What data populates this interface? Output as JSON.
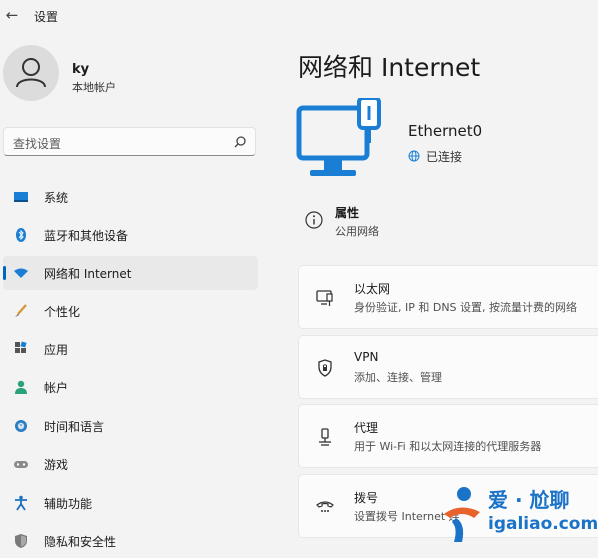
{
  "titlebar": {
    "back_glyph": "←",
    "title": "设置"
  },
  "user": {
    "name": "ky",
    "account_type": "本地帐户"
  },
  "search": {
    "placeholder": "查找设置"
  },
  "sidebar": {
    "items": [
      {
        "label": "系统",
        "icon": "system-icon"
      },
      {
        "label": "蓝牙和其他设备",
        "icon": "bluetooth-icon"
      },
      {
        "label": "网络和 Internet",
        "icon": "network-icon",
        "selected": true
      },
      {
        "label": "个性化",
        "icon": "brush-icon"
      },
      {
        "label": "应用",
        "icon": "apps-icon"
      },
      {
        "label": "帐户",
        "icon": "account-icon"
      },
      {
        "label": "时间和语言",
        "icon": "time-language-icon"
      },
      {
        "label": "游戏",
        "icon": "gamepad-icon"
      },
      {
        "label": "辅助功能",
        "icon": "accessibility-icon"
      },
      {
        "label": "隐私和安全性",
        "icon": "shield-icon"
      }
    ]
  },
  "main": {
    "title": "网络和 Internet",
    "connection": {
      "name": "Ethernet0",
      "status": "已连接"
    },
    "properties": {
      "title": "属性",
      "subtitle": "公用网络"
    },
    "cards": [
      {
        "title": "以太网",
        "subtitle": "身份验证, IP 和 DNS 设置, 按流量计费的网络",
        "icon": "ethernet-icon"
      },
      {
        "title": "VPN",
        "subtitle": "添加、连接、管理",
        "icon": "vpn-shield-icon"
      },
      {
        "title": "代理",
        "subtitle": "用于 Wi-Fi 和以太网连接的代理服务器",
        "icon": "proxy-icon"
      },
      {
        "title": "拨号",
        "subtitle": "设置拨号 Internet 连",
        "icon": "dialup-icon"
      }
    ]
  },
  "watermark": {
    "line1": "爱 · 尬聊",
    "line2": "igaliao.com"
  },
  "colors": {
    "accent": "#0067c0",
    "monitor_blue": "#1a7fd4",
    "watermark_blue": "#1a73c8"
  }
}
